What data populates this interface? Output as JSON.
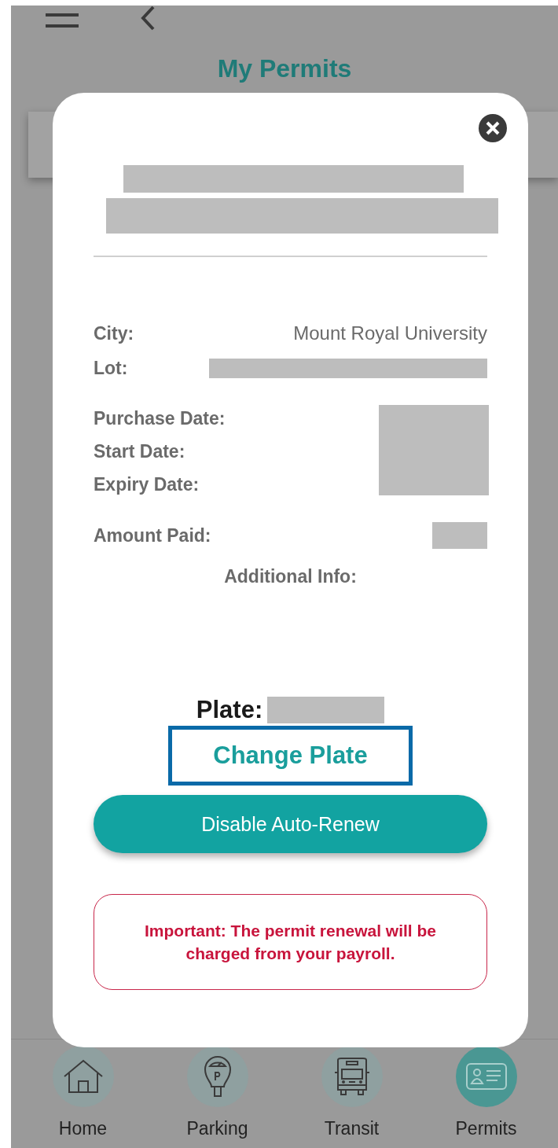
{
  "header": {
    "title": "My Permits"
  },
  "modal": {
    "rows": [
      {
        "label": "City:",
        "kind": "text",
        "value": "Mount Royal University"
      },
      {
        "label": "Lot:",
        "kind": "redacted"
      }
    ],
    "dates": [
      "Purchase Date:",
      "Start Date:",
      "Expiry Date:"
    ],
    "amount": {
      "label": "Amount Paid:"
    },
    "additional": {
      "label": "Additional Info:"
    },
    "plate": {
      "label": "Plate:"
    },
    "change_plate": {
      "label": "Change Plate",
      "highlighted": true
    },
    "auto_renew": {
      "label": "Disable Auto-Renew"
    },
    "notice": "Important: The permit renewal will be charged from your payroll."
  },
  "nav": [
    {
      "label": "Home",
      "kind": "home",
      "selected": false
    },
    {
      "label": "Parking",
      "kind": "meter",
      "selected": false
    },
    {
      "label": "Transit",
      "kind": "bus",
      "selected": false
    },
    {
      "label": "Permits",
      "kind": "card",
      "selected": true
    }
  ]
}
